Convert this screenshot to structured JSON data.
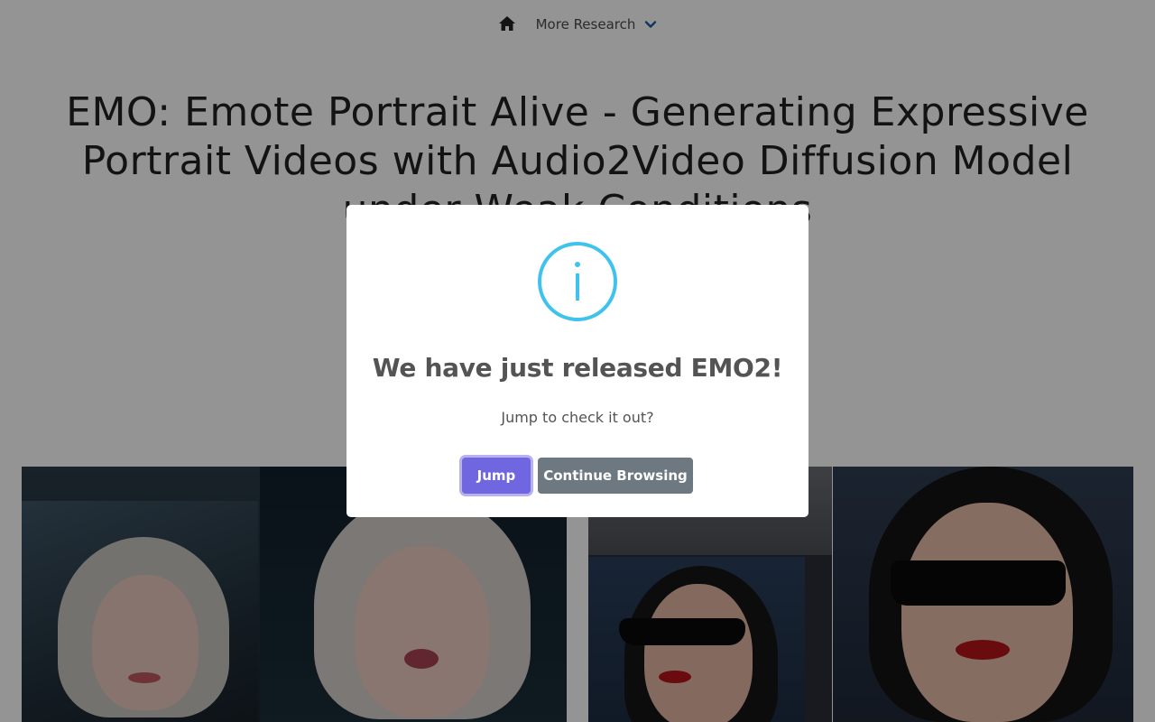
{
  "nav": {
    "home_icon": "home-icon",
    "more_research_label": "More Research",
    "chevron_icon": "chevron-down-icon",
    "accent_color": "#1e5aa8"
  },
  "page": {
    "title": "EMO: Emote Portrait Alive - Generating Expressive Portrait Videos with Audio2Video Diffusion Model under Weak Conditions"
  },
  "modal": {
    "icon": "info-icon",
    "icon_color": "#3fc3ee",
    "title": "We have just released EMO2!",
    "text": "Jump to check it out?",
    "jump_label": "Jump",
    "continue_label": "Continue Browsing",
    "jump_color": "#7066e0",
    "continue_color": "#6e7881"
  }
}
